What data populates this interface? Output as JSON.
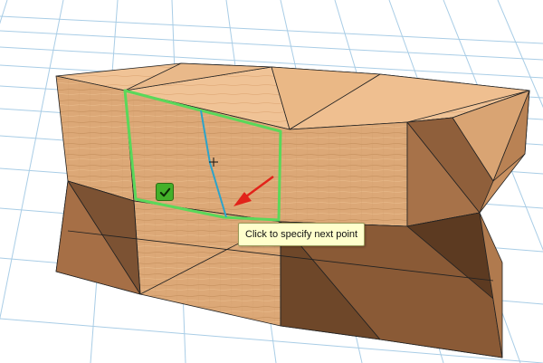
{
  "viewport": {
    "tooltip_text": "Click to specify next point",
    "confirm_icon": "checkmark-icon",
    "cursor_icon": "crosshair-cursor",
    "arrow_icon": "red-arrow-indicator"
  },
  "colors": {
    "background": "#ffffff",
    "grid": "#a9cde6",
    "wood_light": "#e8b98a",
    "wood_mid": "#d7a271",
    "wood_dark": "#9c6b43",
    "edge": "#222222",
    "selection": "#5ad85a",
    "sketch_line": "#2ea3c9",
    "arrow": "#e2231a",
    "tooltip_bg": "#ffffcc",
    "confirm_bg": "#43b02a"
  }
}
